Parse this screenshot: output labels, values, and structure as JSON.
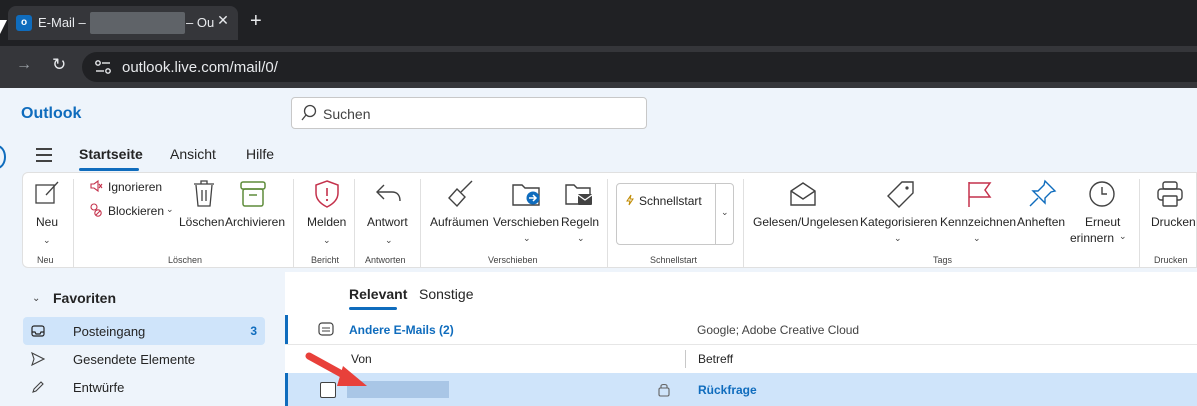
{
  "browser": {
    "tab": {
      "favicon_letter": "o",
      "title_start": "E-Mail –",
      "title_end": "– Ou",
      "close_glyph": "✕"
    },
    "new_tab_glyph": "+",
    "url": "outlook.live.com/mail/0/"
  },
  "outlook": {
    "brand": "Outlook",
    "search_placeholder": "Suchen",
    "nav_tabs": [
      "Startseite",
      "Ansicht",
      "Hilfe"
    ],
    "ribbon": {
      "neu": "Neu",
      "ignorieren": "Ignorieren",
      "blockieren": "Blockieren",
      "loeschen": "Löschen",
      "archivieren": "Archivieren",
      "melden": "Melden",
      "antwort": "Antwort",
      "aufraeumen": "Aufräumen",
      "verschieben": "Verschieben",
      "regeln": "Regeln",
      "schnellstart": "Schnellstart",
      "gelesen": "Gelesen/Ungelesen",
      "kategorisieren": "Kategorisieren",
      "kennzeichnen": "Kennzeichnen",
      "anheften": "Anheften",
      "erneut_1": "Erneut",
      "erneut_2": "erinnern",
      "drucken": "Drucken",
      "groups": {
        "neu": "Neu",
        "loeschen": "Löschen",
        "bericht": "Bericht",
        "antworten": "Antworten",
        "verschieben": "Verschieben",
        "schnellstart": "Schnellstart",
        "tags": "Tags",
        "drucken": "Drucken"
      }
    },
    "sidebar": {
      "favorites_label": "Favoriten",
      "folders": [
        {
          "label": "Posteingang",
          "count": "3",
          "icon": "inbox-icon",
          "selected": true
        },
        {
          "label": "Gesendete Elemente",
          "count": "",
          "icon": "send-icon",
          "selected": false
        },
        {
          "label": "Entwürfe",
          "count": "",
          "icon": "pencil-icon",
          "selected": false
        }
      ]
    },
    "mail_list": {
      "pivots": [
        "Relevant",
        "Sonstige"
      ],
      "group_row": {
        "label": "Andere E-Mails (2)",
        "senders": "Google; Adobe Creative Cloud"
      },
      "columns": {
        "from": "Von",
        "subject": "Betreff"
      },
      "message": {
        "subject": "Rückfrage"
      }
    }
  },
  "colors": {
    "accent": "#0f6cbd",
    "selected": "#cfe4fa",
    "arrow": "#e8403a",
    "flag": "#c4314b"
  }
}
